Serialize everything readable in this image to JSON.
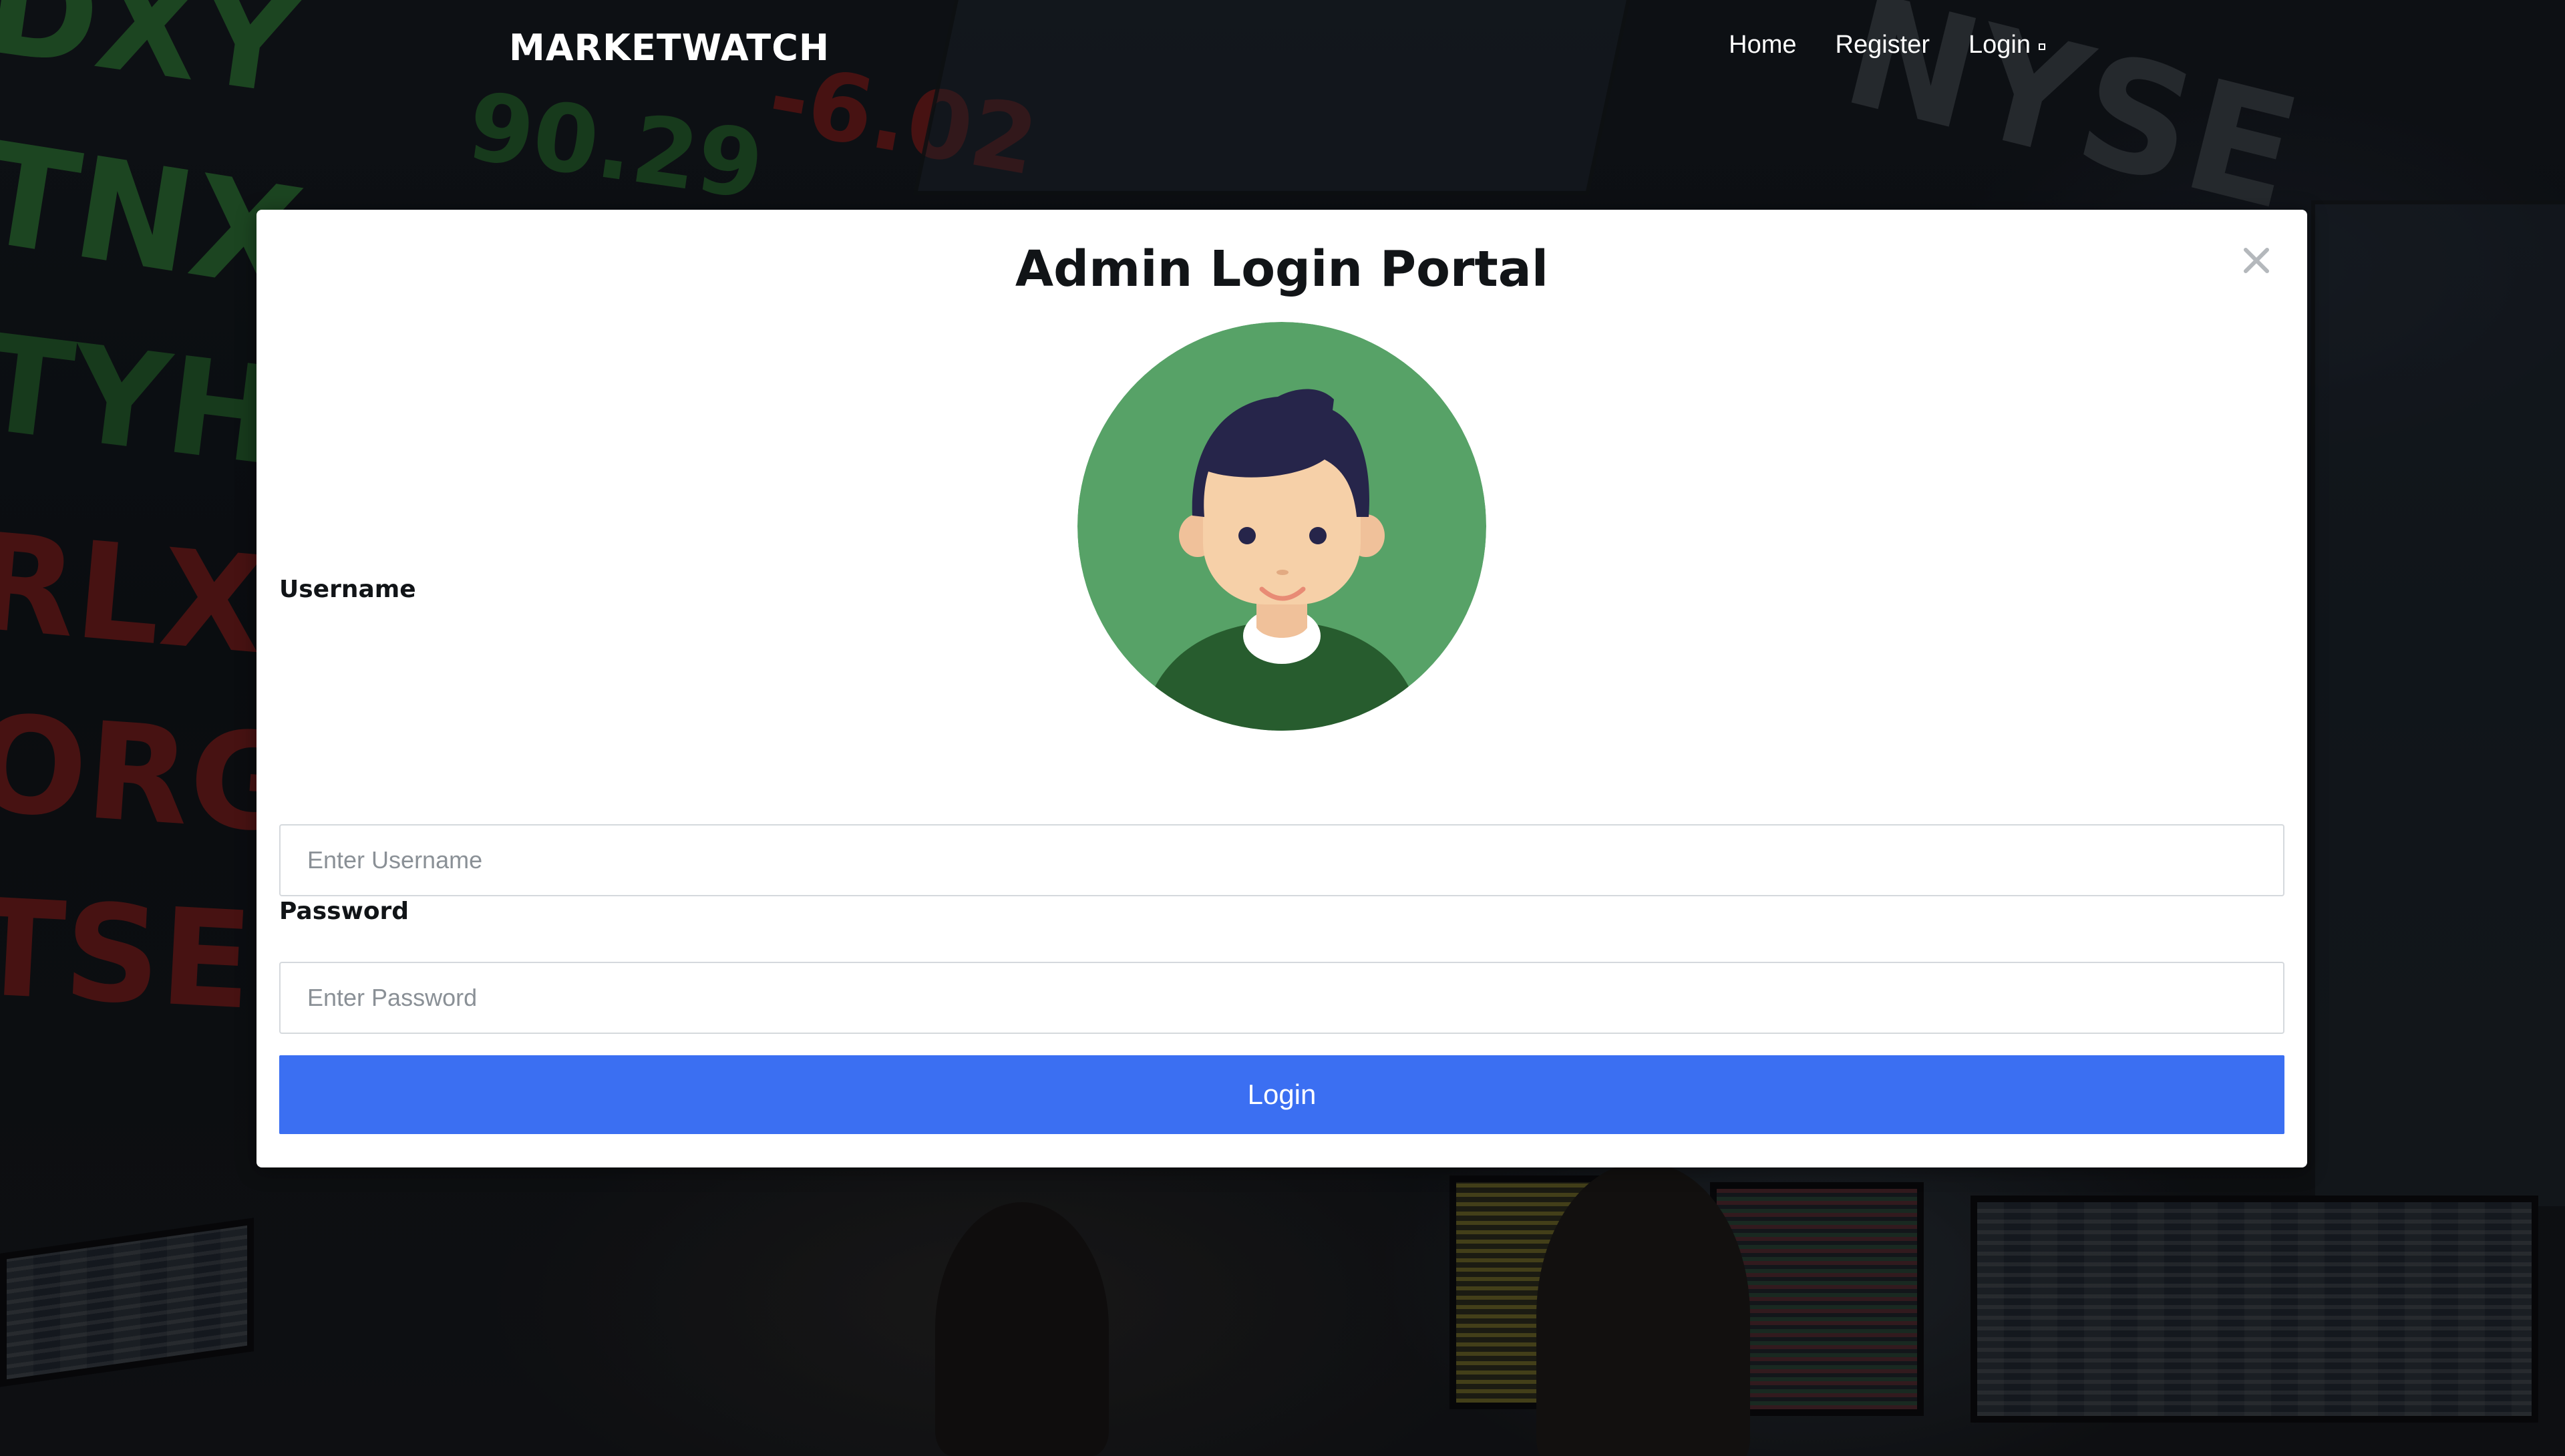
{
  "navbar": {
    "brand": "MARKETWATCH",
    "links": [
      {
        "label": "Home"
      },
      {
        "label": "Register"
      },
      {
        "label": "Login"
      }
    ]
  },
  "modal": {
    "title": "Admin Login Portal",
    "close_icon": "close-icon",
    "avatar_icon": "user-avatar-icon",
    "username": {
      "label": "Username",
      "placeholder": "Enter Username",
      "value": ""
    },
    "password": {
      "label": "Password",
      "placeholder": "Enter Password",
      "value": ""
    },
    "submit_label": "Login"
  },
  "background": {
    "tickers": [
      "DXY",
      "TNX",
      "TYH",
      "RLX",
      "ORG",
      "TSE",
      "90.29",
      "-6.02",
      "NYSE"
    ]
  },
  "colors": {
    "accent": "#3b6ff2",
    "modal_bg": "#ffffff",
    "title_text": "#111417",
    "avatar_bg": "#57a267",
    "ticker_green": "#2d6e35",
    "ticker_red": "#7a1f1f"
  }
}
